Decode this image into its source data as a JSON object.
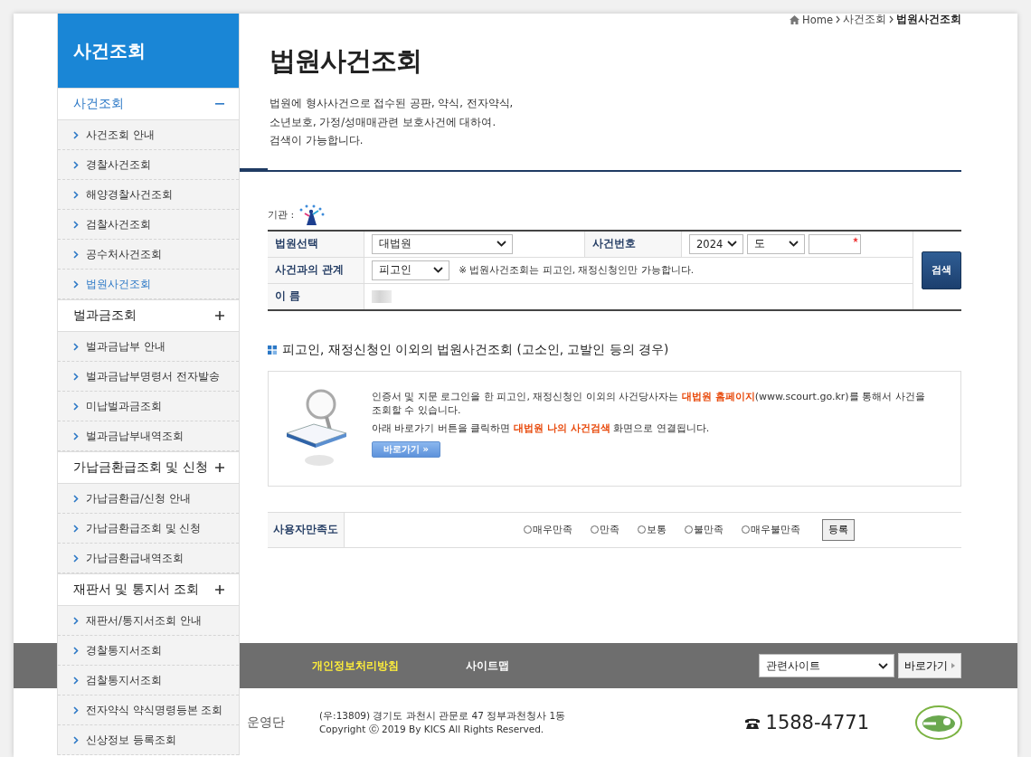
{
  "sidebar": {
    "title": "사건조회",
    "groups": [
      {
        "title": "사건조회",
        "expanded": true,
        "items": [
          {
            "label": "사건조회 안내",
            "selected": false
          },
          {
            "label": "경찰사건조회",
            "selected": false
          },
          {
            "label": "해양경찰사건조회",
            "selected": false
          },
          {
            "label": "검찰사건조회",
            "selected": false
          },
          {
            "label": "공수처사건조회",
            "selected": false
          },
          {
            "label": "법원사건조회",
            "selected": true
          }
        ]
      },
      {
        "title": "벌과금조회",
        "expanded": false,
        "items": [
          {
            "label": "벌과금납부 안내",
            "selected": false
          },
          {
            "label": "벌과금납부명령서 전자발송",
            "selected": false
          },
          {
            "label": "미납벌과금조회",
            "selected": false
          },
          {
            "label": "벌과금납부내역조회",
            "selected": false
          }
        ]
      },
      {
        "title": "가납금환급조회 및 신청",
        "expanded": false,
        "items": [
          {
            "label": "가납금환급/신청 안내",
            "selected": false
          },
          {
            "label": "가납금환급조회 및 신청",
            "selected": false
          },
          {
            "label": "가납금환급내역조회",
            "selected": false
          }
        ]
      },
      {
        "title": "재판서 및 통지서 조회",
        "expanded": false,
        "items": [
          {
            "label": "재판서/통지서조회 안내",
            "selected": false
          },
          {
            "label": "경찰통지서조회",
            "selected": false
          },
          {
            "label": "검찰통지서조회",
            "selected": false
          },
          {
            "label": "전자약식 약식명령등본 조회",
            "selected": false
          },
          {
            "label": "신상정보 등록조회",
            "selected": false
          }
        ]
      }
    ]
  },
  "breadcrumb": [
    "Home",
    "사건조회",
    "법원사건조회"
  ],
  "page_title": "법원사건조회",
  "description": [
    "법원에 형사사건으로 접수된 공판, 약식, 전자약식,",
    "소년보호, 가정/성매매관련 보호사건에 대하여.",
    "검색이 가능합니다."
  ],
  "agency_label": "기관 :",
  "form": {
    "court_label": "법원선택",
    "court_value": "대법원",
    "case_number_label": "사건번호",
    "year_value": "2024",
    "case_type_value": "도",
    "relation_label": "사건과의 관계",
    "relation_value": "피고인",
    "relation_note": "※ 법원사건조회는 피고인, 재정신청인만 가능합니다.",
    "name_label": "이 름",
    "search_button": "검색"
  },
  "other_section": {
    "heading": "피고인, 재정신청인 이외의 법원사건조회 (고소인, 고발인 등의 경우)",
    "line1": "인증서 및 지문 로그인을 한 피고인, 재정신청인 이외의 사건당사자는 **대법원 홈페이지**(www.scourt.go.kr)를 통해서 사건을 조회할 수 있습니다.",
    "line2": "아래 바로가기 버튼을 클릭하면 **대법원 나의 사건검색** 화면으로 연결됩니다.",
    "button": "바로가기 »"
  },
  "satisfaction": {
    "label": "사용자만족도",
    "options": [
      {
        "label": "매우만족",
        "selected": false
      },
      {
        "label": "만족",
        "selected": false
      },
      {
        "label": "보통",
        "selected": false
      },
      {
        "label": "불만족",
        "selected": false
      },
      {
        "label": "매우불만족",
        "selected": false
      }
    ],
    "submit": "등록"
  },
  "footer": {
    "links": [
      {
        "label": "개인정보처리방침",
        "highlighted": true
      },
      {
        "label": "사이트맵",
        "highlighted": false
      }
    ],
    "related_sites": "관련사이트",
    "go_button": "바로가기",
    "operator": "운영단",
    "address": "(우:13809) 경기도 과천시 관문로 47 정부과천청사 1동",
    "copyright": "Copyright ⓒ 2019 By KICS All Rights Reserved.",
    "phone": "1588-4771"
  }
}
